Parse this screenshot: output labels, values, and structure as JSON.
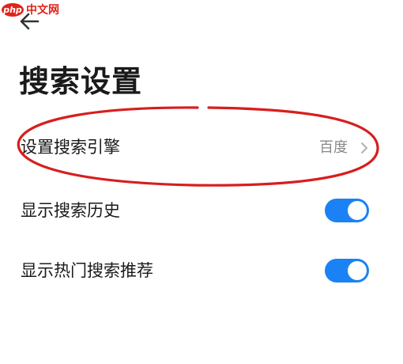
{
  "watermark": {
    "logo": "php",
    "text": "中文网"
  },
  "header": {
    "back_icon": "arrow-left-icon",
    "title": "搜索设置"
  },
  "settings": {
    "engine": {
      "label": "设置搜索引擎",
      "value": "百度",
      "icon": "chevron-right-icon"
    },
    "history": {
      "label": "显示搜索历史",
      "enabled": true
    },
    "hot": {
      "label": "显示热门搜索推荐",
      "enabled": true
    }
  },
  "colors": {
    "toggle_on": "#1a82f5",
    "annotation": "#d81e1e",
    "watermark": "#e2231a"
  }
}
